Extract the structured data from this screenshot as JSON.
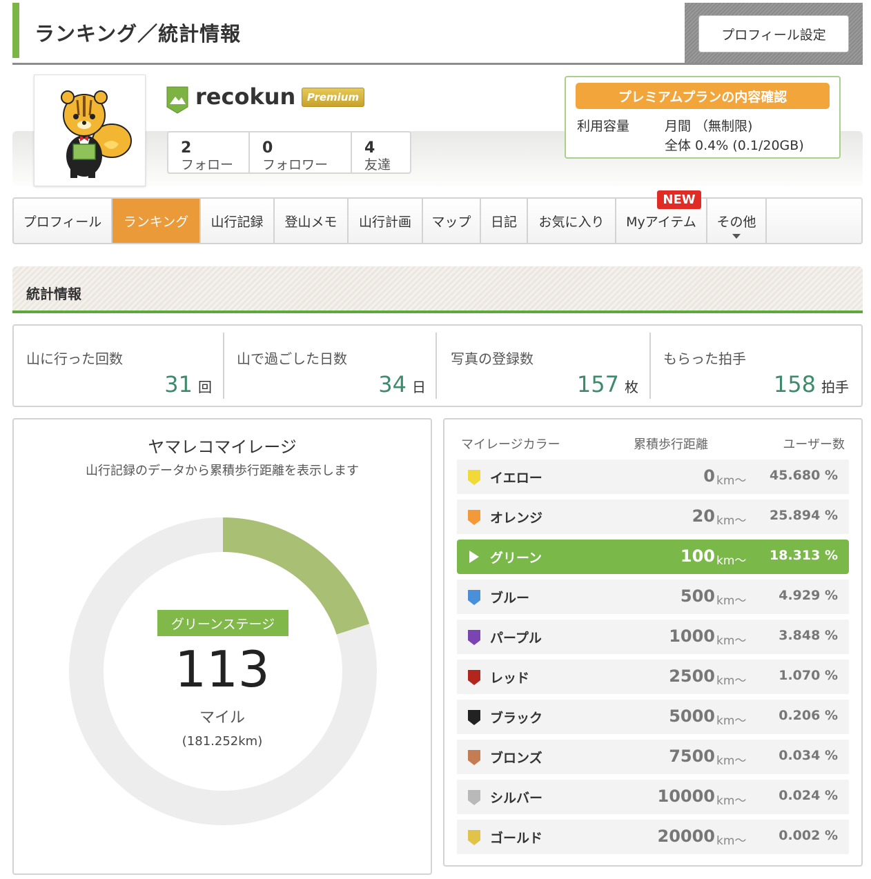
{
  "header": {
    "title": "ランキング／統計情報",
    "settings_label": "プロフィール設定"
  },
  "profile": {
    "username": "recokun",
    "badge": "Premium",
    "counts": [
      {
        "num": "2",
        "label": "フォロー"
      },
      {
        "num": "0",
        "label": "フォロワー"
      },
      {
        "num": "4",
        "label": "友達"
      }
    ]
  },
  "plan": {
    "button": "プレミアムプランの内容確認",
    "label": "利用容量",
    "line1": "月間 （無制限)",
    "line2": "全体 0.4% (0.1/20GB)"
  },
  "tabs": [
    {
      "label": "プロフィール"
    },
    {
      "label": "ランキング"
    },
    {
      "label": "山行記録"
    },
    {
      "label": "登山メモ"
    },
    {
      "label": "山行計画"
    },
    {
      "label": "マップ"
    },
    {
      "label": "日記"
    },
    {
      "label": "お気に入り"
    },
    {
      "label": "Myアイテム"
    },
    {
      "label": "その他"
    }
  ],
  "new_badge": "NEW",
  "section": {
    "title": "統計情報"
  },
  "stats": [
    {
      "label": "山に行った回数",
      "value": "31",
      "unit": "回"
    },
    {
      "label": "山で過ごした日数",
      "value": "34",
      "unit": "日"
    },
    {
      "label": "写真の登録数",
      "value": "157",
      "unit": "枚"
    },
    {
      "label": "もらった拍手",
      "value": "158",
      "unit": "拍手"
    }
  ],
  "mileage": {
    "title": "ヤマレコマイレージ",
    "subtitle": "山行記録のデータから累積歩行距離を表示します",
    "stage": "グリーンステージ",
    "miles": "113",
    "unit": "マイル",
    "km": "(181.252km)",
    "progress_fraction": 0.2,
    "fill_color": "#a9bf73",
    "track_color": "#ededed"
  },
  "color_table": {
    "headers": {
      "color": "マイレージカラー",
      "distance": "累積歩行距離",
      "users": "ユーザー数"
    },
    "km_suffix": "km〜",
    "active": "グリーン",
    "rows": [
      {
        "name": "イエロー",
        "distance": "0",
        "pct": "45.680 %",
        "color": "#f1d93a"
      },
      {
        "name": "オレンジ",
        "distance": "20",
        "pct": "25.894 %",
        "color": "#f29a3a"
      },
      {
        "name": "グリーン",
        "distance": "100",
        "pct": "18.313 %",
        "color": "#7ab84a"
      },
      {
        "name": "ブルー",
        "distance": "500",
        "pct": "4.929 %",
        "color": "#4a90d9"
      },
      {
        "name": "パープル",
        "distance": "1000",
        "pct": "3.848 %",
        "color": "#7a45b0"
      },
      {
        "name": "レッド",
        "distance": "2500",
        "pct": "1.070 %",
        "color": "#b3261e"
      },
      {
        "name": "ブラック",
        "distance": "5000",
        "pct": "0.206 %",
        "color": "#222222"
      },
      {
        "name": "ブロンズ",
        "distance": "7500",
        "pct": "0.034 %",
        "color": "#c47d52"
      },
      {
        "name": "シルバー",
        "distance": "10000",
        "pct": "0.024 %",
        "color": "#b9b9b9"
      },
      {
        "name": "ゴールド",
        "distance": "20000",
        "pct": "0.002 %",
        "color": "#e0c44a"
      }
    ]
  }
}
